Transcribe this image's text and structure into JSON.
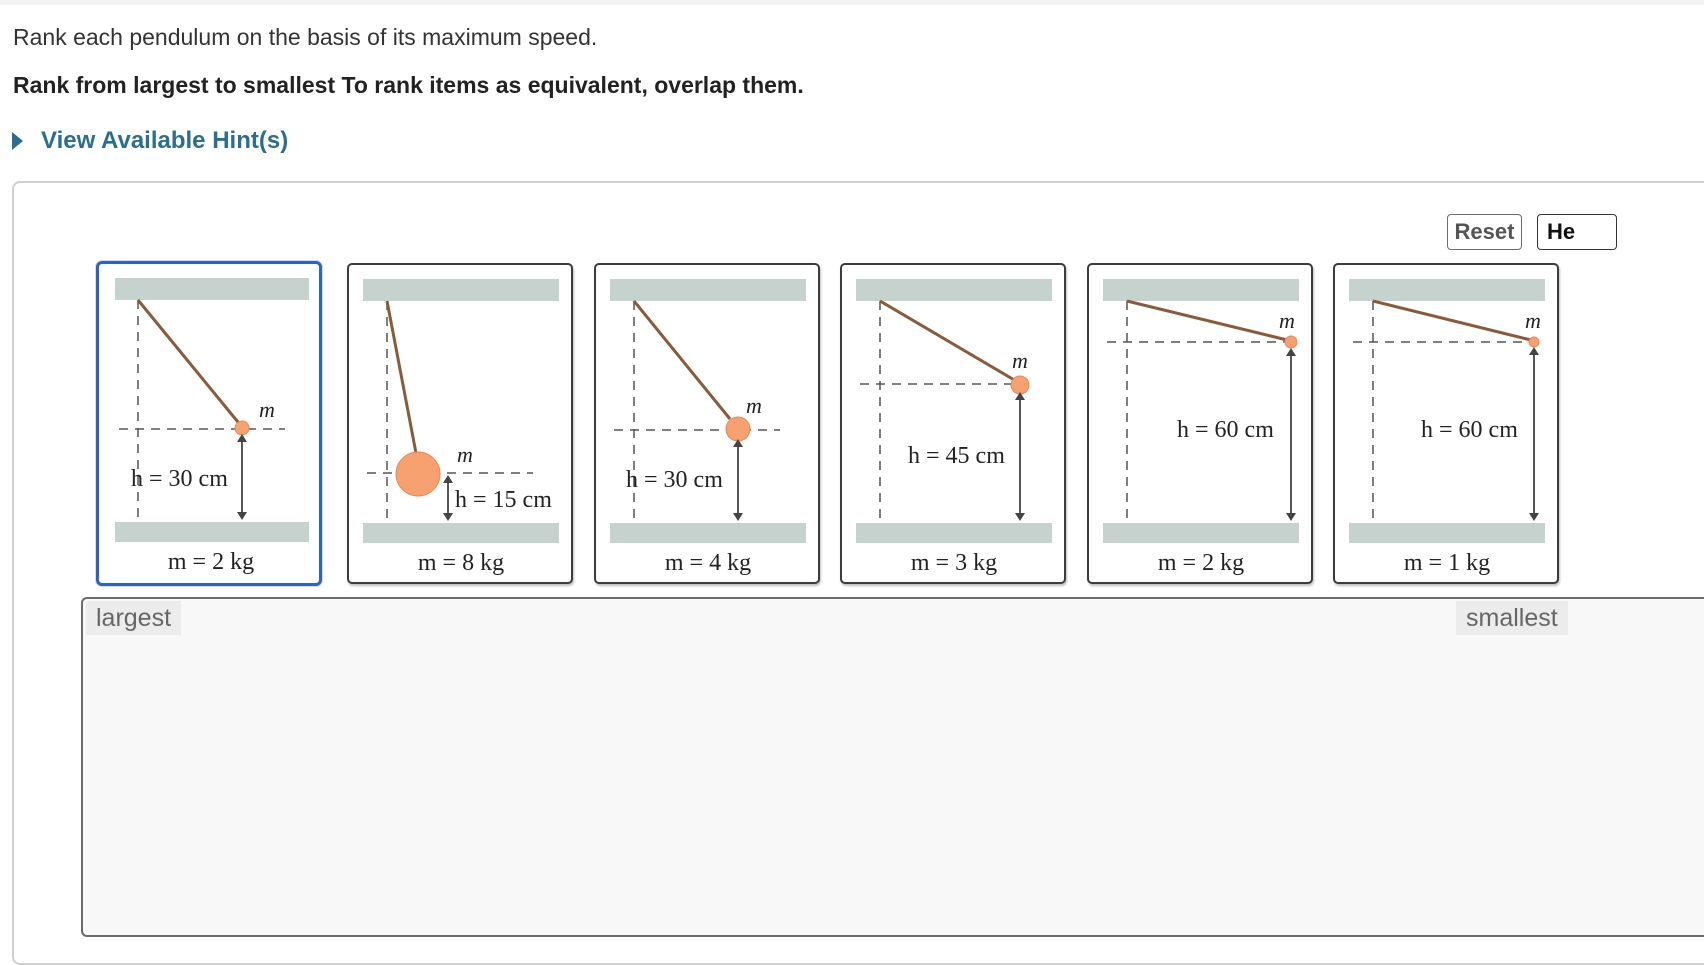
{
  "question": {
    "instruction": "Rank each pendulum on the basis of its maximum speed.",
    "rank_rule": "Rank from largest to smallest To rank items as equivalent, overlap them.",
    "hint_link": "View Available Hint(s)"
  },
  "toolbar": {
    "reset_label": "Reset",
    "help_label": "He"
  },
  "cards": [
    {
      "h_label": "h = 30 cm",
      "m_label": "m = 2 kg",
      "bob_label": "m",
      "selected": true
    },
    {
      "h_label": "h = 15 cm",
      "m_label": "m = 8 kg",
      "bob_label": "m",
      "selected": false
    },
    {
      "h_label": "h = 30 cm",
      "m_label": "m = 4 kg",
      "bob_label": "m",
      "selected": false
    },
    {
      "h_label": "h = 45 cm",
      "m_label": "m = 3 kg",
      "bob_label": "m",
      "selected": false
    },
    {
      "h_label": "h = 60 cm",
      "m_label": "m = 2 kg",
      "bob_label": "m",
      "selected": false
    },
    {
      "h_label": "h = 60 cm",
      "m_label": "m = 1 kg",
      "bob_label": "m",
      "selected": false
    }
  ],
  "dropzone": {
    "largest_label": "largest",
    "smallest_label": "smallest"
  },
  "colors": {
    "accent": "#2a6f8f",
    "selected_border": "#2b62c8",
    "bob": "#f7a070",
    "string": "#8a5a3a",
    "ceiling": "#c5d2cd"
  }
}
